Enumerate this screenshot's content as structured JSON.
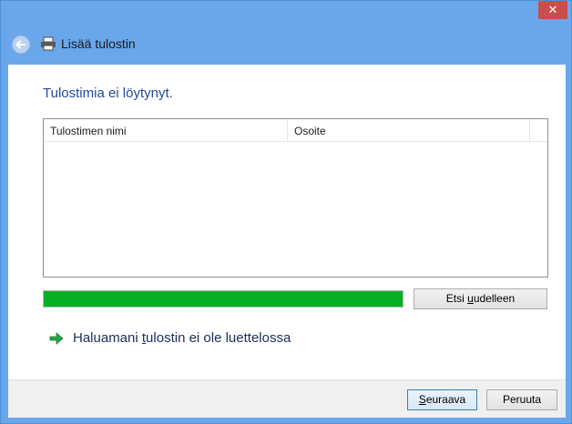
{
  "window": {
    "title": "Lisää tulostin",
    "close_glyph": "✕",
    "accent": "#6aa7ea"
  },
  "main": {
    "heading": "Tulostimia ei löytynyt.",
    "list": {
      "columns": [
        "Tulostimen nimi",
        "Osoite"
      ],
      "rows": []
    },
    "progress": {
      "value": 1.0,
      "color": "#06b025"
    },
    "search_again_label": {
      "before": "Etsi ",
      "underlined": "u",
      "after": "udelleen"
    },
    "missing_printer_link": {
      "before": "Haluamani ",
      "underlined": "t",
      "after": "ulostin ei ole luettelossa"
    }
  },
  "footer": {
    "next_label": {
      "underlined": "S",
      "after": "euraava"
    },
    "cancel_label": "Peruuta"
  },
  "icons": {
    "back": "back-arrow-icon",
    "printer": "printer-icon",
    "link_arrow": "green-arrow-icon"
  }
}
